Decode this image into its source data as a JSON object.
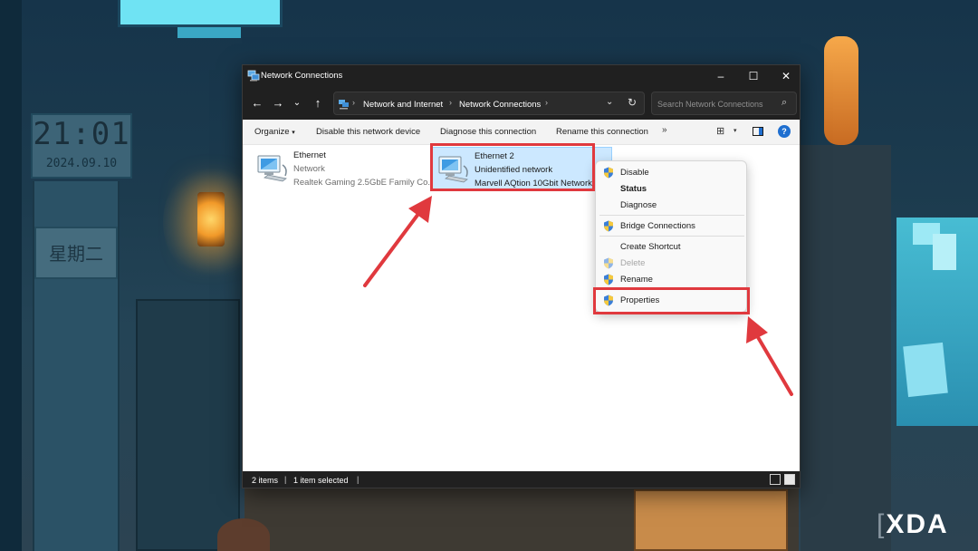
{
  "wallpaper": {
    "clock_time": "21:01",
    "clock_date": "2024.09.10",
    "weekday_sign": "星期二",
    "watermark_prefix": "[",
    "watermark_text": "XDA"
  },
  "window": {
    "title": "Network Connections",
    "controls": {
      "minimize": "–",
      "maximize": "☐",
      "close": "✕"
    },
    "nav": {
      "back": "←",
      "forward": "→",
      "history": "⌄",
      "up": "↑"
    },
    "address": {
      "crumbs": [
        "Network and Internet",
        "Network Connections"
      ],
      "separator": "›",
      "dropdown": "⌄",
      "refresh": "↻"
    },
    "search": {
      "placeholder": "Search Network Connections"
    },
    "commands": {
      "organize": "Organize",
      "disable": "Disable this network device",
      "diagnose": "Diagnose this connection",
      "rename": "Rename this connection",
      "more": "»"
    },
    "items": [
      {
        "name": "Ethernet",
        "status": "Network",
        "device": "Realtek Gaming 2.5GbE Family Co...",
        "selected": false
      },
      {
        "name": "Ethernet 2",
        "status": "Unidentified network",
        "device": "Marvell AQtion 10Gbit Network",
        "selected": true
      }
    ],
    "status": {
      "count": "2 items",
      "selected": "1 item selected",
      "sep": "|"
    }
  },
  "context_menu": {
    "items": [
      {
        "label": "Disable",
        "shield": true,
        "bold": false,
        "disabled": false
      },
      {
        "label": "Status",
        "shield": false,
        "bold": true,
        "disabled": false
      },
      {
        "label": "Diagnose",
        "shield": false,
        "bold": false,
        "disabled": false
      },
      {
        "label": "Bridge Connections",
        "shield": true,
        "bold": false,
        "disabled": false
      },
      {
        "label": "Create Shortcut",
        "shield": false,
        "bold": false,
        "disabled": false
      },
      {
        "label": "Delete",
        "shield": true,
        "bold": false,
        "disabled": true
      },
      {
        "label": "Rename",
        "shield": true,
        "bold": false,
        "disabled": false
      },
      {
        "label": "Properties",
        "shield": true,
        "bold": false,
        "disabled": false
      }
    ]
  },
  "annotations": {
    "highlight_color": "#e0393e"
  }
}
